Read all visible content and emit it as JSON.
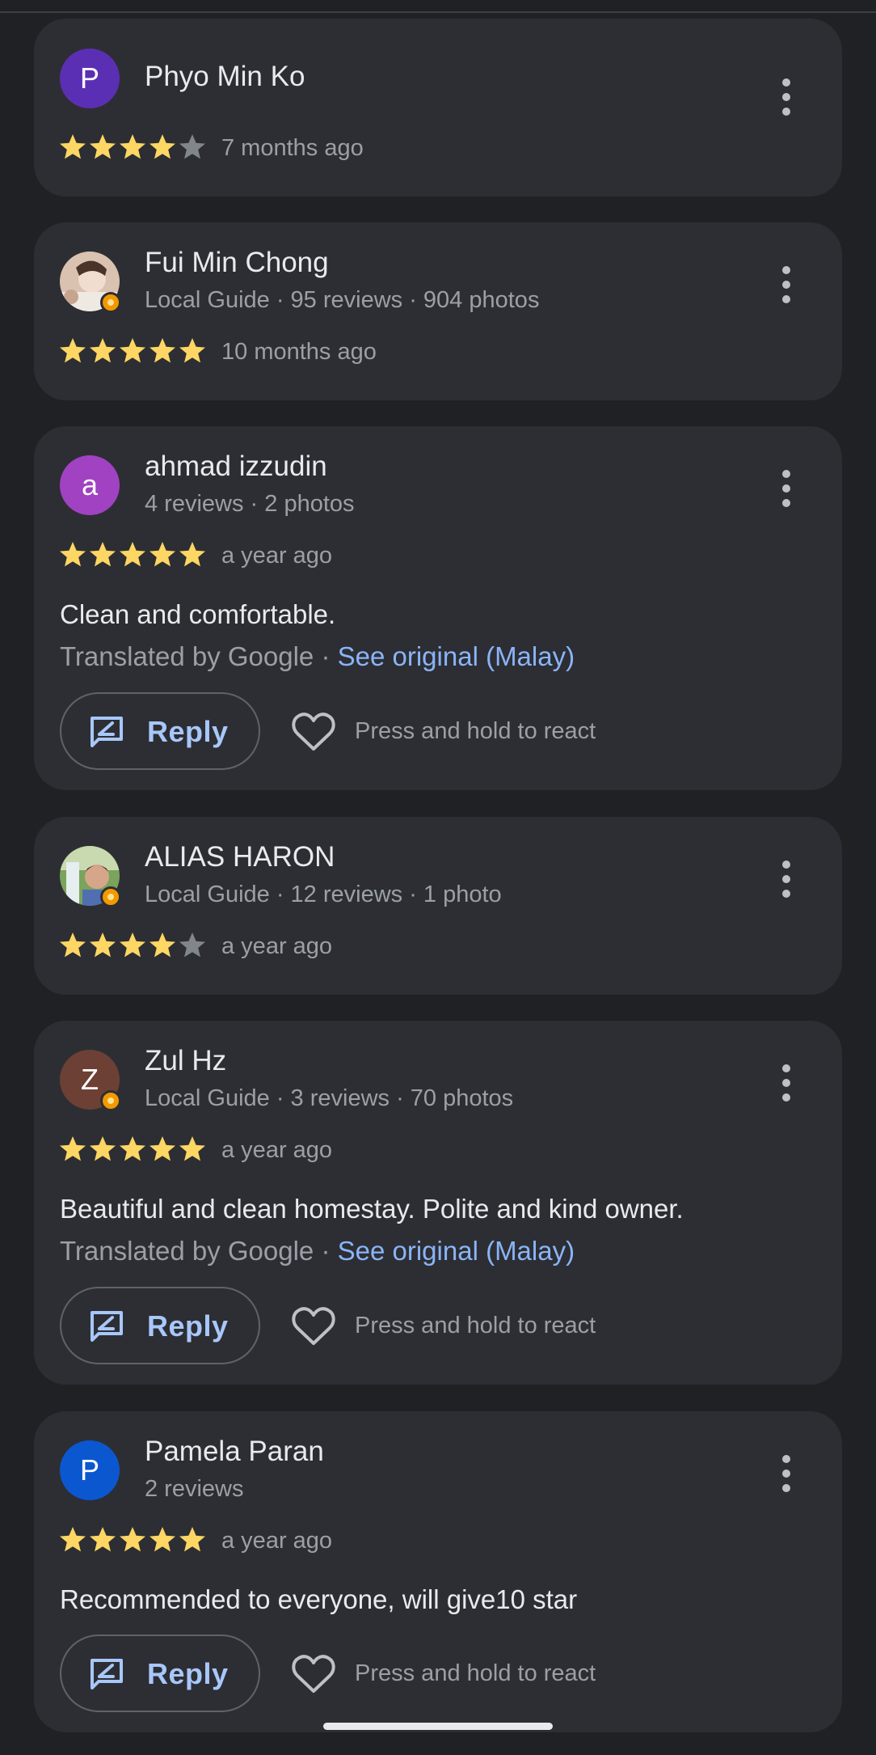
{
  "colors": {
    "background": "#202124",
    "card": "#2d2e33",
    "star_filled": "#fdd663",
    "star_empty": "#80868b",
    "link": "#8ab4f8"
  },
  "icons": {
    "more": "more-vert-icon",
    "reply": "reply-edit-icon",
    "react": "heart-outline-icon",
    "star": "star-icon",
    "badge": "local-guide-badge-icon"
  },
  "reviews": [
    {
      "avatar_letter": "P",
      "avatar_color": "#5b2fb4",
      "name": "Phyo Min Ko",
      "meta": "",
      "rating": 4,
      "when": "7 months ago"
    },
    {
      "avatar_letter": "",
      "name": "Fui Min Chong",
      "meta": "Local Guide · 95 reviews · 904 photos",
      "rating": 5,
      "when": "10 months ago"
    },
    {
      "avatar_letter": "a",
      "avatar_color": "#a142c2",
      "name": "ahmad izzudin",
      "meta": "4 reviews · 2 photos",
      "rating": 5,
      "when": "a year ago",
      "text": "Clean and comfortable.",
      "translated_by": "Translated by Google · ",
      "see_original": "See original (Malay)",
      "reply_label": "Reply",
      "react_label": "Press and hold to react"
    },
    {
      "avatar_letter": "",
      "name": "ALIAS HARON",
      "meta": "Local Guide · 12 reviews · 1 photo",
      "rating": 4,
      "when": "a year ago"
    },
    {
      "avatar_letter": "Z",
      "avatar_color": "#6d4035",
      "name": "Zul Hz",
      "meta": "Local Guide · 3 reviews · 70 photos",
      "rating": 5,
      "when": "a year ago",
      "text": "Beautiful and clean homestay. Polite and kind owner.",
      "translated_by": "Translated by Google · ",
      "see_original": "See original (Malay)",
      "reply_label": "Reply",
      "react_label": "Press and hold to react"
    },
    {
      "avatar_letter": "P",
      "avatar_color": "#0b57d0",
      "name": "Pamela Paran",
      "meta": "2 reviews",
      "rating": 5,
      "when": "a year ago",
      "text": "Recommended to everyone, will give10 star",
      "reply_label": "Reply",
      "react_label": "Press and hold to react"
    }
  ]
}
